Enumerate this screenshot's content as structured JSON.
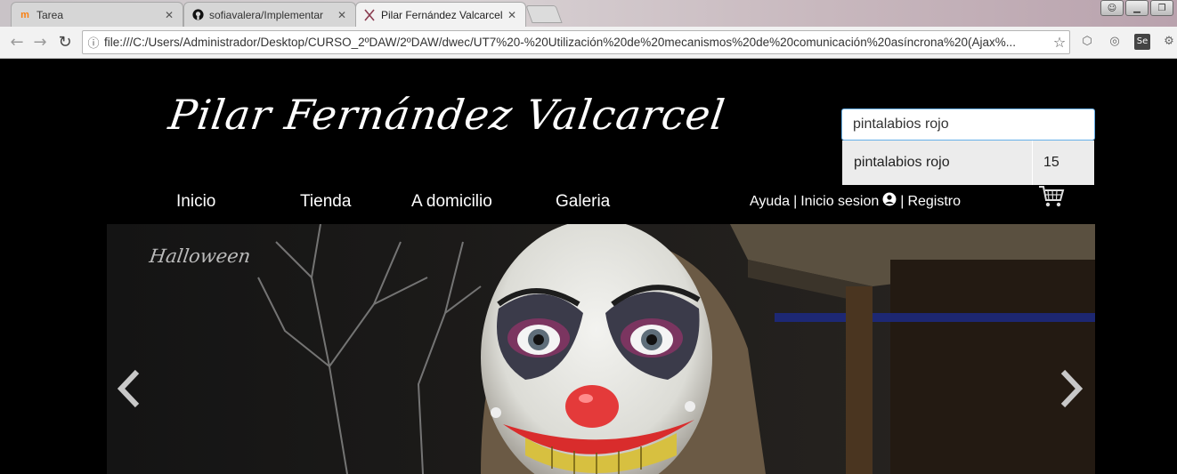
{
  "browser": {
    "tabs": [
      {
        "label": "Tarea",
        "icon": "moodle-icon"
      },
      {
        "label": "sofiavalera/Implementar",
        "icon": "github-icon"
      },
      {
        "label": "Pilar Fernández Valcarcel",
        "icon": "scissors-icon",
        "active": true
      }
    ],
    "url": "file:///C:/Users/Administrador/Desktop/CURSO_2ºDAW/2ºDAW/dwec/UT7%20-%20Utilización%20de%20mecanismos%20de%20comunicación%20asíncrona%20(Ajax%..."
  },
  "header": {
    "brand": "Pilar Fernández Valcarcel",
    "search_value": "pintalabios rojo",
    "suggestion": {
      "name": "pintalabios rojo",
      "count": "15"
    }
  },
  "nav": {
    "items": [
      "Inicio",
      "Tienda",
      "A domicilio",
      "Galeria"
    ]
  },
  "userlinks": {
    "help": "Ayuda",
    "sep": "|",
    "login": "Inicio sesion",
    "register": "Registro"
  },
  "carousel": {
    "caption": "Halloween"
  },
  "colors": {
    "page_bg": "#000000",
    "search_focus": "#66afe9",
    "suggest_bg": "#ececec"
  }
}
